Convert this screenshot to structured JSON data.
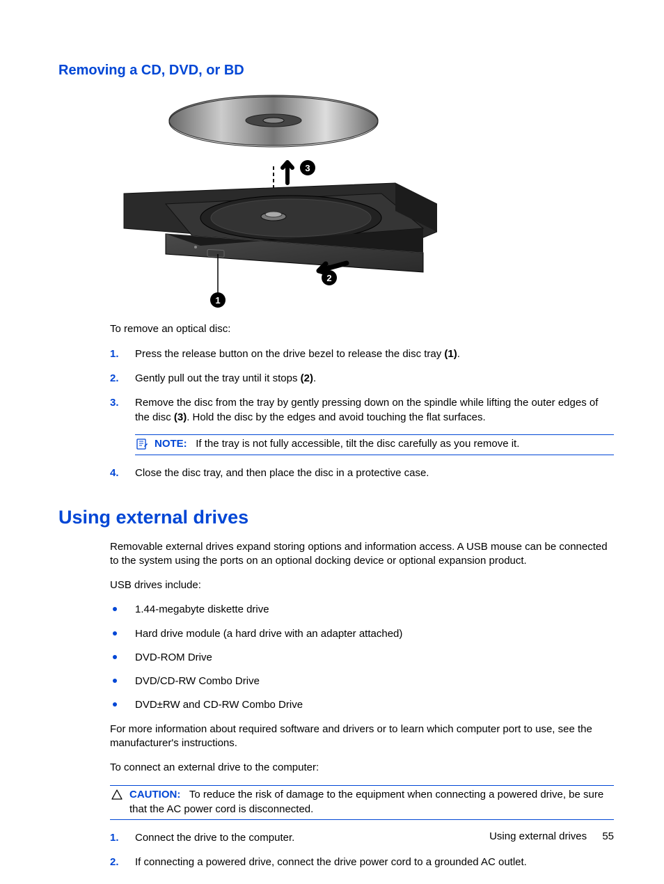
{
  "section1": {
    "heading": "Removing a CD, DVD, or BD",
    "intro": "To remove an optical disc:",
    "steps": [
      {
        "pre": "Press the release button on the drive bezel to release the disc tray ",
        "bold": "(1)",
        "post": "."
      },
      {
        "pre": "Gently pull out the tray until it stops ",
        "bold": "(2)",
        "post": "."
      },
      {
        "pre": "Remove the disc from the tray by gently pressing down on the spindle while lifting the outer edges of the disc ",
        "bold": "(3)",
        "post": ". Hold the disc by the edges and avoid touching the flat surfaces."
      },
      {
        "pre": "Close the disc tray, and then place the disc in a protective case.",
        "bold": "",
        "post": ""
      }
    ],
    "note": {
      "label": "NOTE:",
      "text": "If the tray is not fully accessible, tilt the disc carefully as you remove it."
    }
  },
  "section2": {
    "heading": "Using external drives",
    "para1": "Removable external drives expand storing options and information access. A USB mouse can be connected to the system using the ports on an optional docking device or optional expansion product.",
    "para2": "USB drives include:",
    "bullets": [
      "1.44-megabyte diskette drive",
      "Hard drive module (a hard drive with an adapter attached)",
      "DVD-ROM Drive",
      "DVD/CD-RW Combo Drive",
      "DVD±RW and CD-RW Combo Drive"
    ],
    "para3": "For more information about required software and drivers or to learn which computer port to use, see the manufacturer's instructions.",
    "para4": "To connect an external drive to the computer:",
    "caution": {
      "label": "CAUTION:",
      "text": "To reduce the risk of damage to the equipment when connecting a powered drive, be sure that the AC power cord is disconnected."
    },
    "steps2": [
      "Connect the drive to the computer.",
      "If connecting a powered drive, connect the drive power cord to a grounded AC outlet."
    ]
  },
  "footer": {
    "title": "Using external drives",
    "page": "55"
  }
}
